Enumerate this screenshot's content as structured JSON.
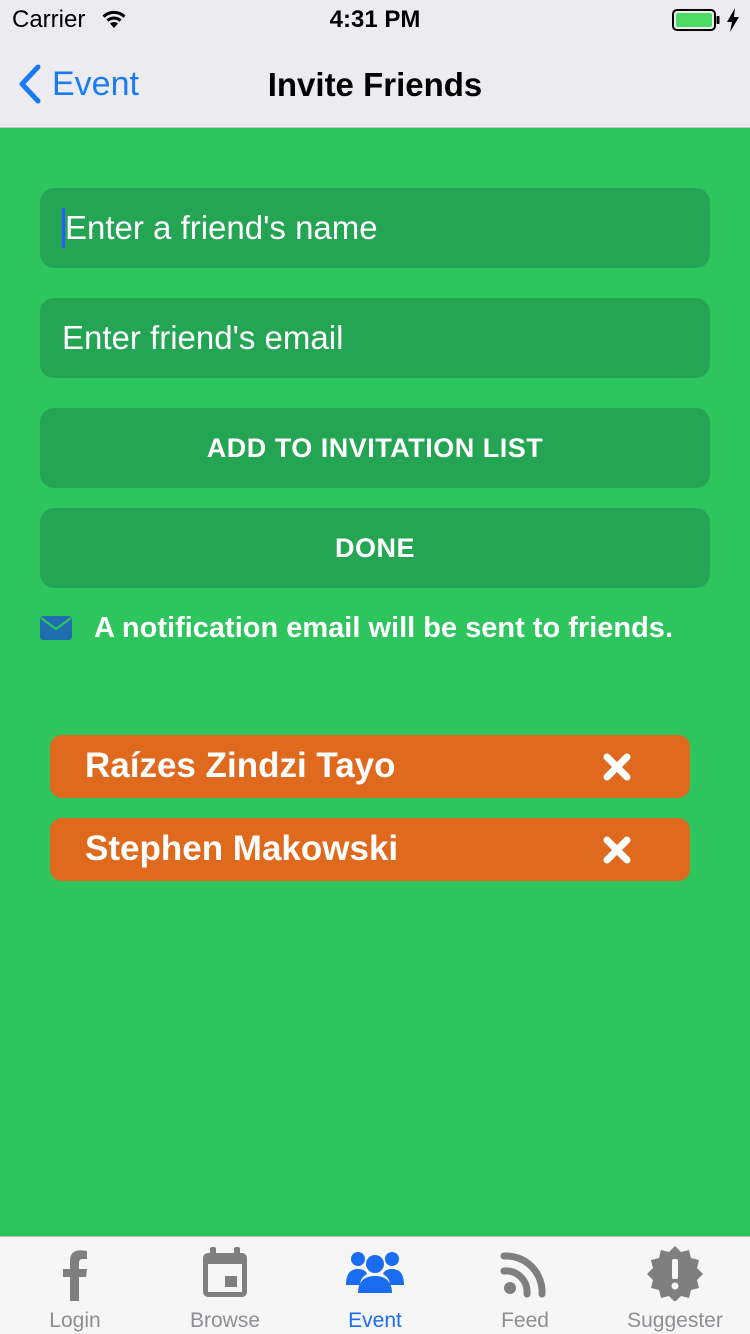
{
  "status_bar": {
    "carrier": "Carrier",
    "time": "4:31 PM"
  },
  "nav": {
    "back_label": "Event",
    "title": "Invite Friends"
  },
  "form": {
    "name_placeholder": "Enter a friend's name",
    "email_placeholder": "Enter friend's email",
    "add_button": "ADD TO INVITATION LIST",
    "done_button": "DONE",
    "notice": "A notification email will be sent to friends."
  },
  "invitees": [
    {
      "name": "Raízes Zindzi Tayo"
    },
    {
      "name": "Stephen Makowski"
    }
  ],
  "tabs": [
    {
      "label": "Login",
      "icon": "facebook-icon"
    },
    {
      "label": "Browse",
      "icon": "calendar-icon"
    },
    {
      "label": "Event",
      "icon": "group-icon",
      "active": true
    },
    {
      "label": "Feed",
      "icon": "rss-icon"
    },
    {
      "label": "Suggester",
      "icon": "alert-badge-icon"
    }
  ],
  "colors": {
    "background": "#2ec55e",
    "field": "#24a553",
    "chip": "#df6a1d",
    "accent": "#1a6cf0"
  }
}
